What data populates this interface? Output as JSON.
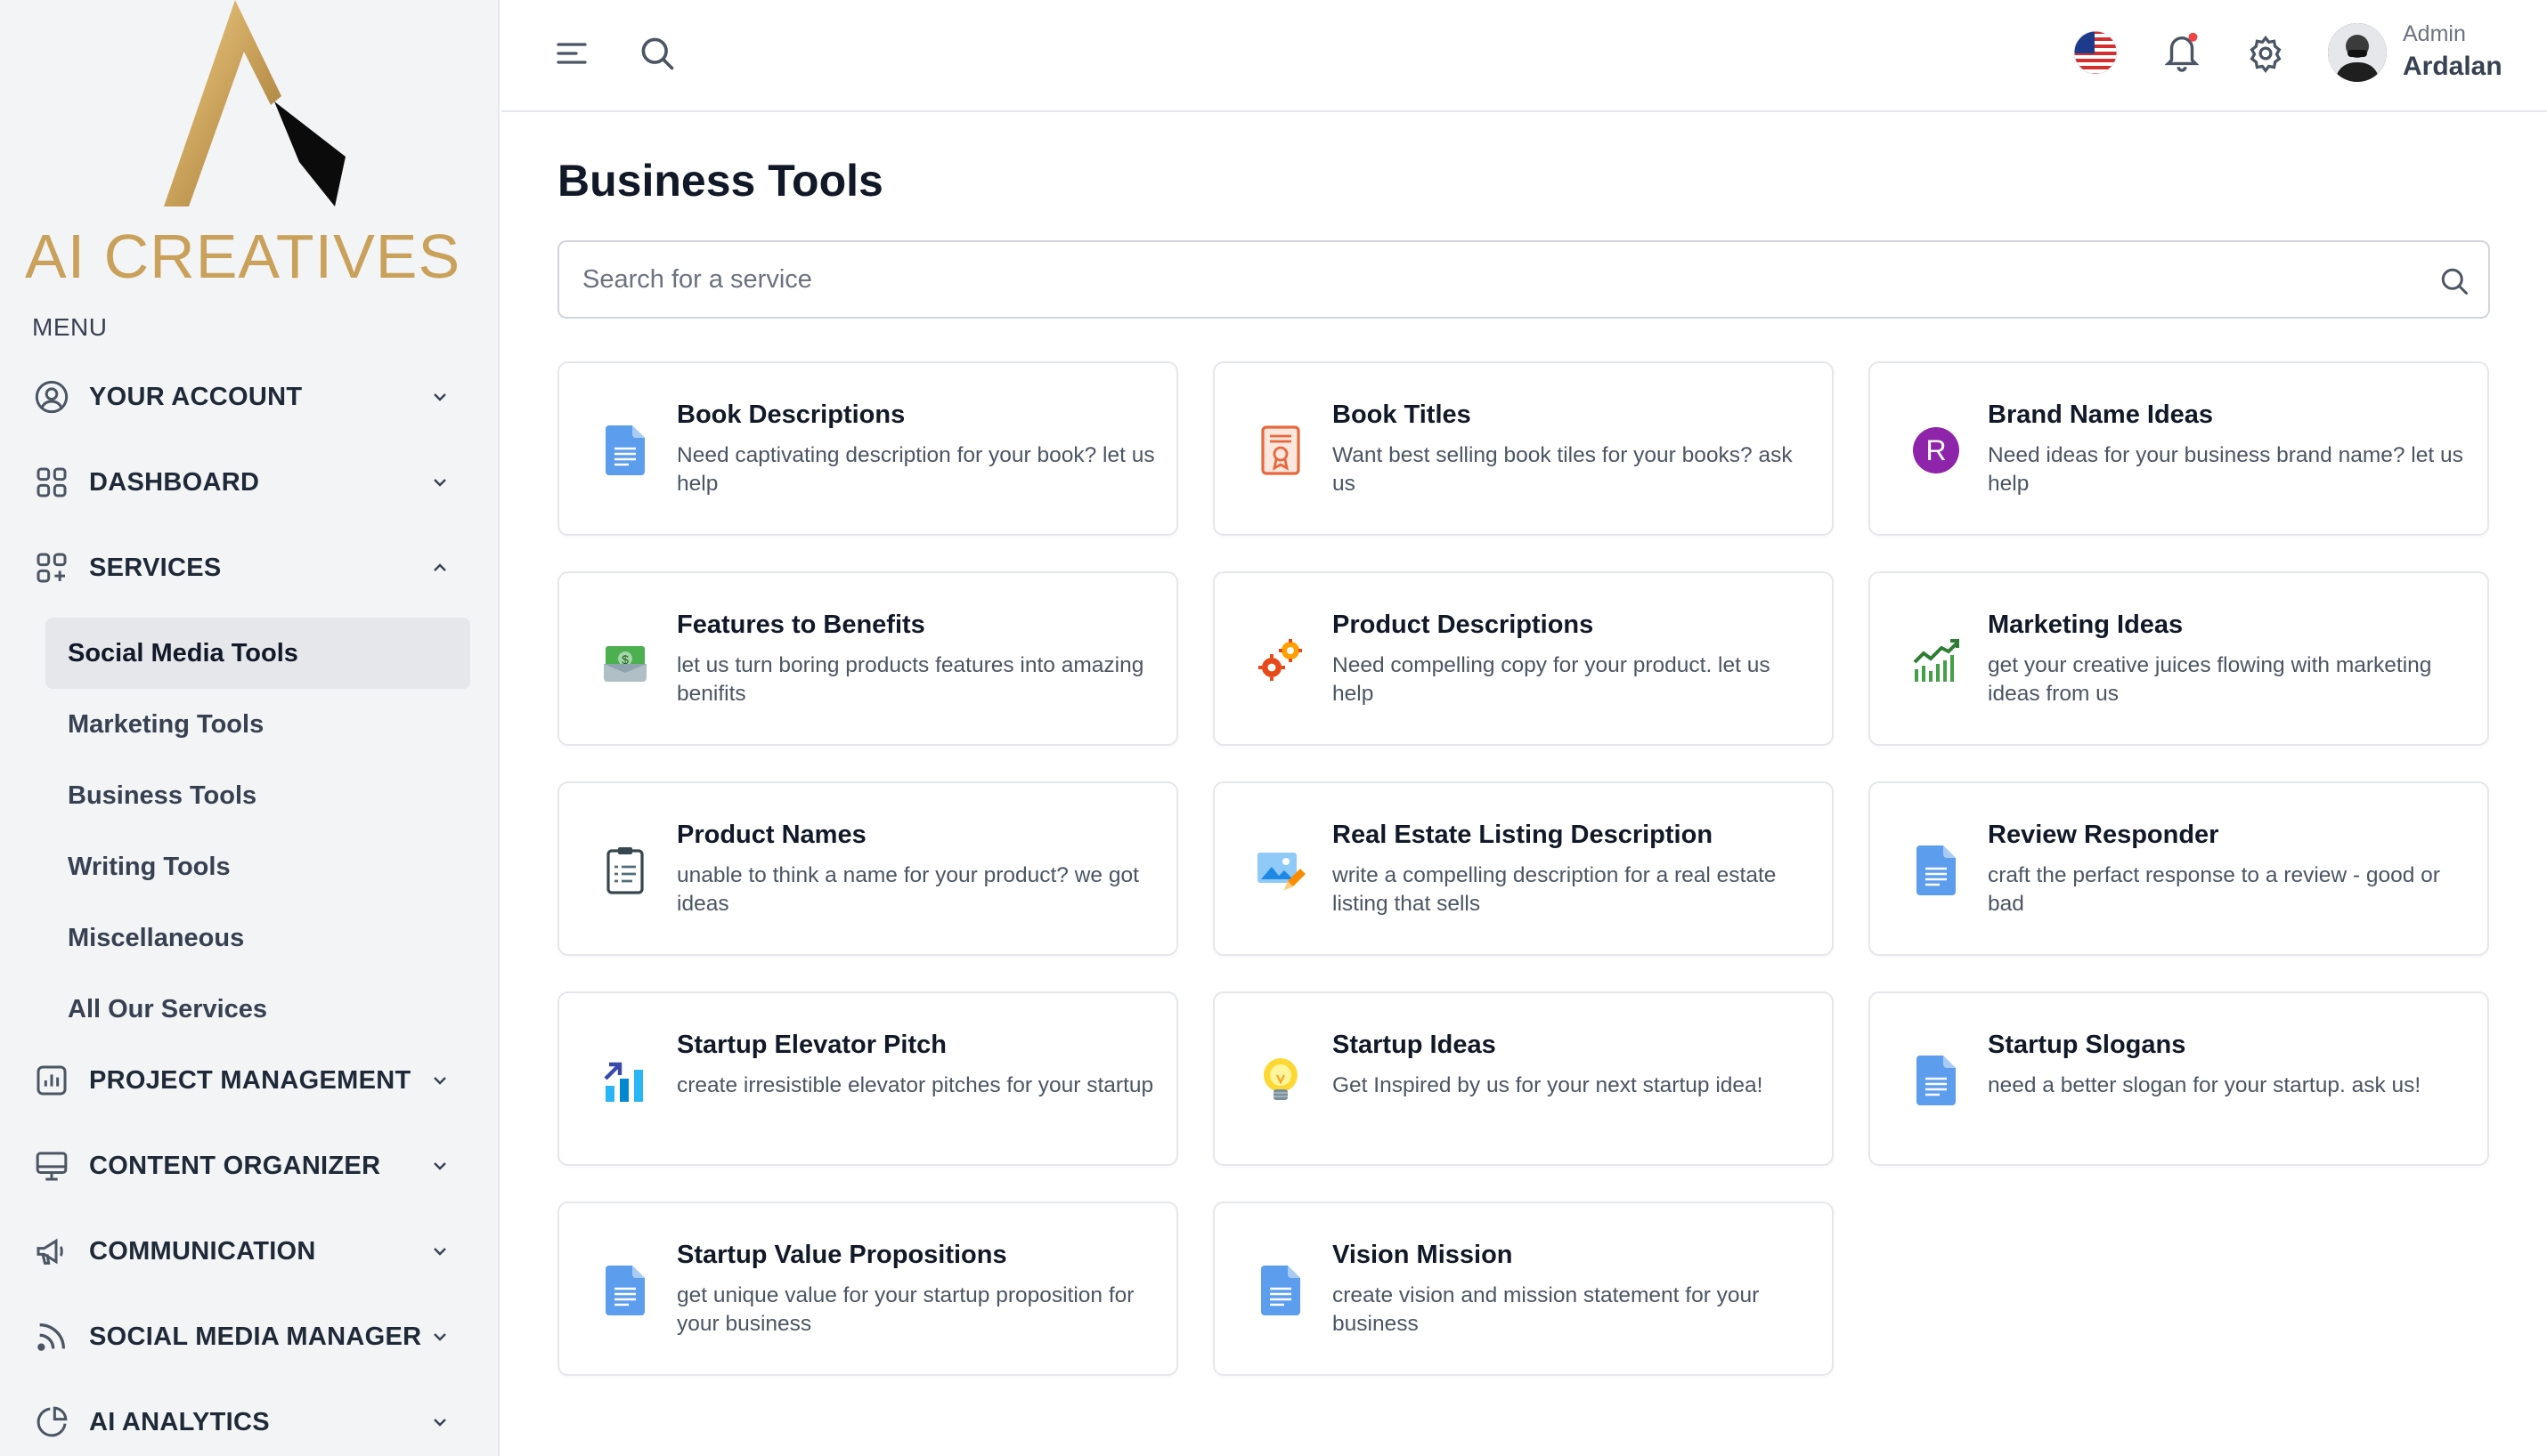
{
  "brand": {
    "name": "AI CREATIVES"
  },
  "sidebar": {
    "menu_heading": "MENU",
    "top_items": [
      {
        "label": "YOUR ACCOUNT",
        "icon": "user-circle-icon"
      },
      {
        "label": "DASHBOARD",
        "icon": "grid-icon"
      },
      {
        "label": "SERVICES",
        "icon": "grid-plus-icon"
      }
    ],
    "services_sub": [
      {
        "label": "Social Media Tools",
        "active": true
      },
      {
        "label": "Marketing Tools"
      },
      {
        "label": "Business Tools"
      },
      {
        "label": "Writing Tools"
      },
      {
        "label": "Miscellaneous"
      },
      {
        "label": "All Our Services"
      }
    ],
    "bottom_items": [
      {
        "label": "PROJECT MANAGEMENT",
        "icon": "chart-box-icon"
      },
      {
        "label": "CONTENT ORGANIZER",
        "icon": "monitor-icon"
      },
      {
        "label": "COMMUNICATION",
        "icon": "megaphone-icon"
      },
      {
        "label": "SOCIAL MEDIA MANAGER",
        "icon": "rss-icon"
      },
      {
        "label": "AI ANALYTICS",
        "icon": "pie-chart-icon"
      }
    ]
  },
  "header": {
    "icons": [
      "menu-icon",
      "search-icon",
      "us-flag-icon",
      "bell-icon",
      "gear-icon",
      "avatar"
    ],
    "user": {
      "role": "Admin",
      "name": "Ardalan"
    }
  },
  "main": {
    "title": "Business Tools",
    "search": {
      "placeholder": "Search for a service",
      "value": ""
    },
    "cards": [
      {
        "title": "Book Descriptions",
        "description": "Need captivating description for your book? let us help",
        "icon": "document-icon"
      },
      {
        "title": "Book Titles",
        "description": "Want best selling book tiles for your books? ask us",
        "icon": "certificate-icon"
      },
      {
        "title": "Brand Name Ideas",
        "description": "Need ideas for your business brand name? let us help",
        "icon": "letter-r-icon"
      },
      {
        "title": "Features to Benefits",
        "description": "let us turn boring products features into amazing benifits",
        "icon": "money-icon"
      },
      {
        "title": "Product Descriptions",
        "description": "Need compelling copy for your product. let us help",
        "icon": "gears-icon"
      },
      {
        "title": "Marketing Ideas",
        "description": "get your creative juices flowing with marketing ideas from us",
        "icon": "growth-chart-icon"
      },
      {
        "title": "Product Names",
        "description": "unable to think a name for your product? we got ideas",
        "icon": "clipboard-icon"
      },
      {
        "title": "Real Estate Listing Description",
        "description": "write a compelling description for a real estate listing that sells",
        "icon": "picture-edit-icon"
      },
      {
        "title": "Review Responder",
        "description": "craft the perfact response to a review - good or bad",
        "icon": "document-icon"
      },
      {
        "title": "Startup Elevator Pitch",
        "description": "create irresistible elevator pitches for your startup",
        "icon": "bar-chart-up-icon"
      },
      {
        "title": "Startup Ideas",
        "description": "Get Inspired by us for your next startup idea!",
        "icon": "lightbulb-icon"
      },
      {
        "title": "Startup Slogans",
        "description": "need a better slogan for your startup. ask us!",
        "icon": "document-icon"
      },
      {
        "title": "Startup Value Propositions",
        "description": "get unique value for your startup proposition for your business",
        "icon": "document-icon"
      },
      {
        "title": "Vision Mission",
        "description": "create vision and mission statement for your business",
        "icon": "document-icon"
      }
    ]
  },
  "colors": {
    "brand_gold": "#c9a15a",
    "sidebar_bg": "#f3f4f6",
    "active_item_bg": "#e5e7eb",
    "notification_dot": "#ef4444",
    "brand_r_purple": "#8e24aa"
  }
}
